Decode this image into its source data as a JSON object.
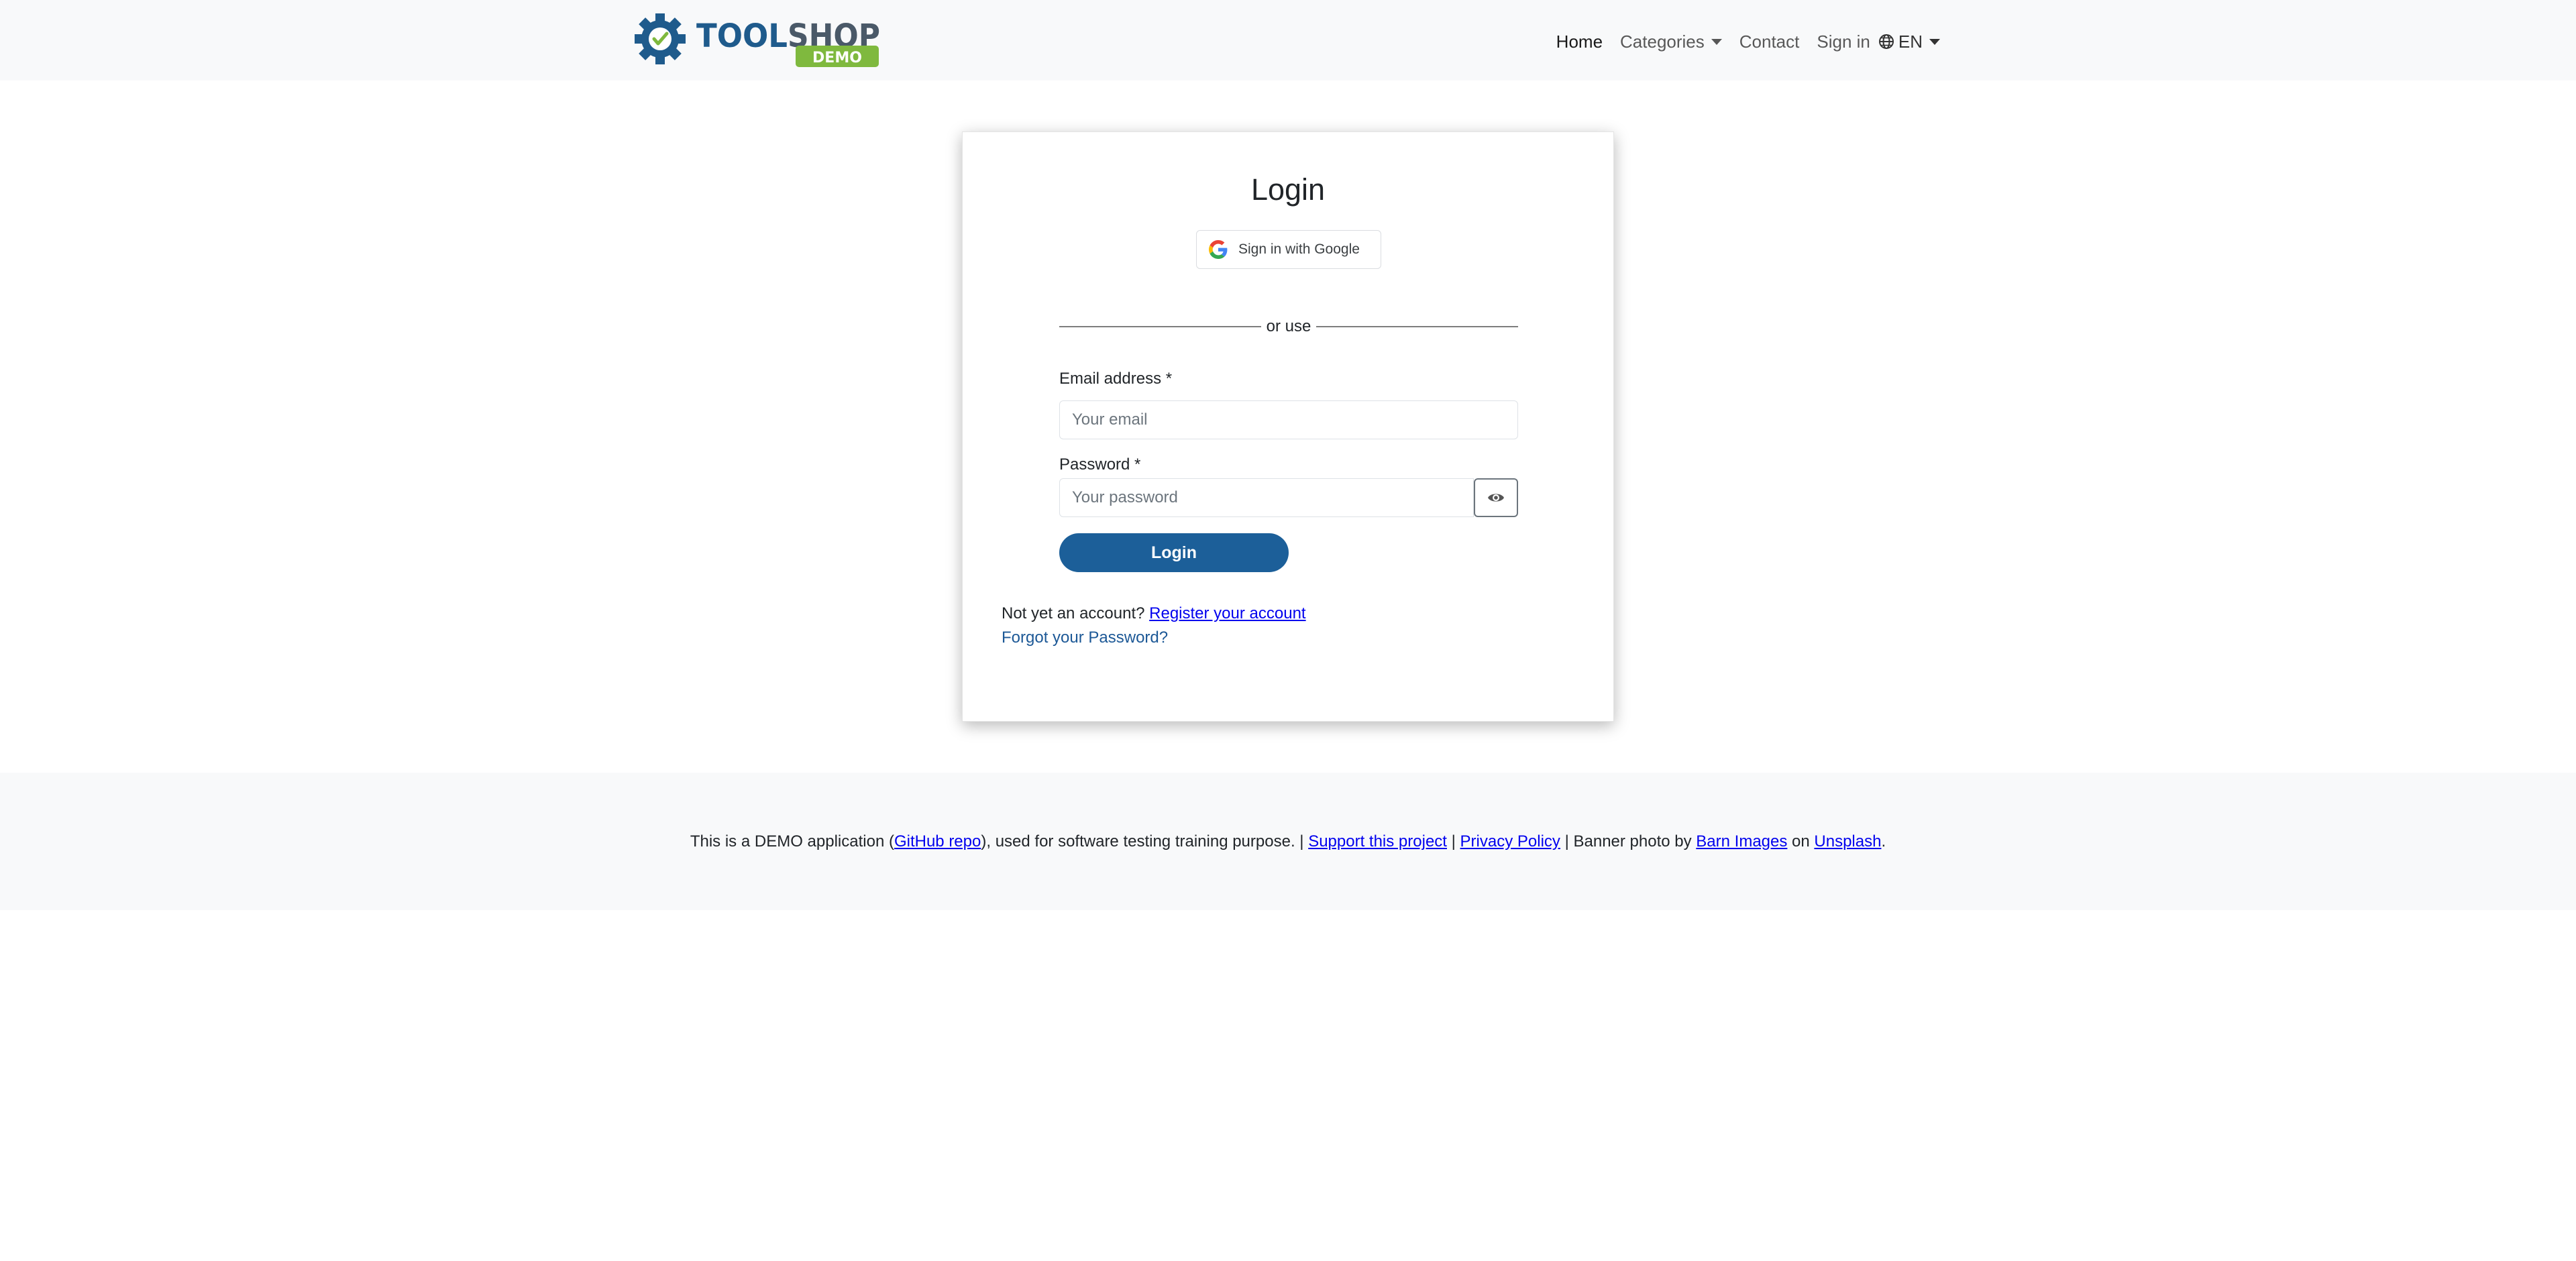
{
  "brand": {
    "name_part1": "TOOL",
    "name_part2": "SHOP",
    "badge": "DEMO",
    "colors": {
      "blue": "#1f5b8c",
      "gray": "#4a5968",
      "green": "#7fb93e"
    }
  },
  "nav": {
    "home": "Home",
    "categories": "Categories",
    "contact": "Contact",
    "sign_in": "Sign in",
    "language": "EN",
    "globe_icon": "globe-icon"
  },
  "login": {
    "title": "Login",
    "google_button": "Sign in with Google",
    "divider": "or use",
    "email_label": "Email address *",
    "email_placeholder": "Your email",
    "email_value": "",
    "password_label": "Password *",
    "password_placeholder": "Your password",
    "password_value": "",
    "submit": "Login",
    "no_account_text": "Not yet an account? ",
    "register_link": "Register your account",
    "forgot_link": "Forgot your Password?",
    "button_color": "#1c5f99"
  },
  "footer": {
    "text1": "This is a DEMO application (",
    "github_link": "GitHub repo",
    "text2": "), used for software testing training purpose. | ",
    "support_link": "Support this project",
    "text3": " | ",
    "privacy_link": "Privacy Policy",
    "text4": " | Banner photo by ",
    "barn_link": "Barn Images",
    "text5": " on ",
    "unsplash_link": "Unsplash",
    "text6": "."
  }
}
